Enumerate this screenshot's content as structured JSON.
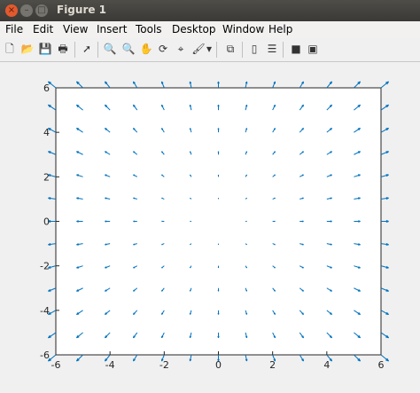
{
  "window": {
    "title": "Figure 1",
    "controls": [
      "close-icon",
      "minimize-icon",
      "maximize-icon"
    ]
  },
  "menubar": {
    "items": [
      "File",
      "Edit",
      "View",
      "Insert",
      "Tools",
      "Desktop",
      "Window",
      "Help"
    ]
  },
  "toolbar": {
    "icons": [
      "new-figure-icon",
      "open-file-icon",
      "save-icon",
      "print-icon",
      "pointer-icon",
      "zoom-in-icon",
      "zoom-out-icon",
      "pan-icon",
      "rotate-3d-icon",
      "data-cursor-icon",
      "brush-icon",
      "brush-dropdown-icon",
      "link-plot-icon",
      "colorbar-icon",
      "legend-icon",
      "hide-plot-tools-icon",
      "show-plot-tools-icon"
    ]
  },
  "chart_data": {
    "type": "quiver",
    "x": [
      -6,
      -5,
      -4,
      -3,
      -2,
      -1,
      0,
      1,
      2,
      3,
      4,
      5,
      6
    ],
    "y": [
      -6,
      -5,
      -4,
      -3,
      -2,
      -1,
      0,
      1,
      2,
      3,
      4,
      5,
      6
    ],
    "field": "u = x, v = y (radial outward)",
    "xlim": [
      -6,
      6
    ],
    "ylim": [
      -6,
      6
    ],
    "xticks": [
      -6,
      -4,
      -2,
      0,
      2,
      4,
      6
    ],
    "yticks": [
      -6,
      -4,
      -2,
      0,
      2,
      4,
      6
    ],
    "color": "#0072bd",
    "grid": false
  }
}
